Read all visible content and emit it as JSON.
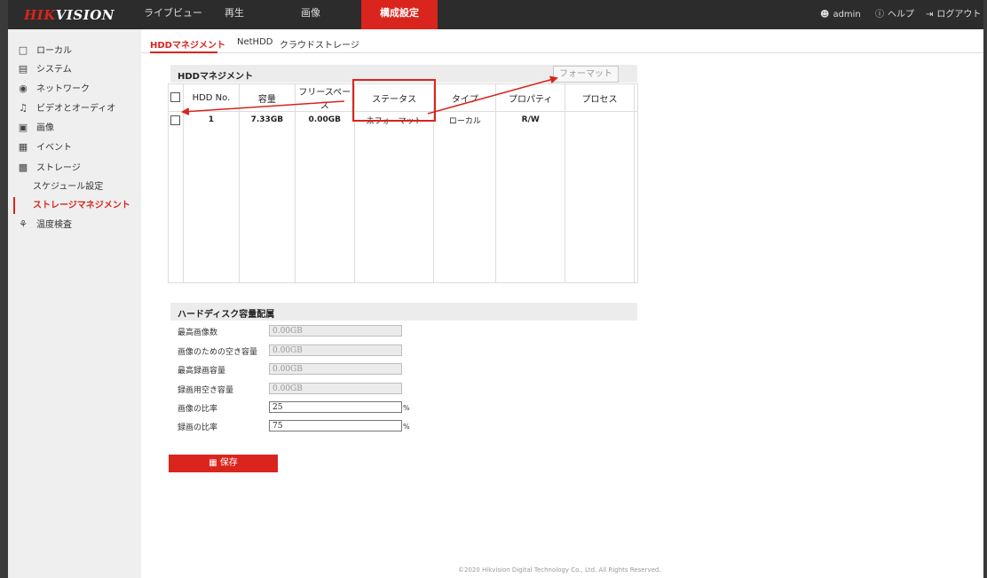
{
  "brand": {
    "red": "HIK",
    "white": "VISION"
  },
  "nav": [
    {
      "label": "ライブビュー",
      "active": false
    },
    {
      "label": "再生",
      "active": false
    },
    {
      "label": "画像",
      "active": false
    },
    {
      "label": "構成設定",
      "active": true
    }
  ],
  "user_menu": {
    "user": "admin",
    "help": "ヘルプ",
    "logout": "ログアウト"
  },
  "sidebar": {
    "items": [
      {
        "label": "ローカル",
        "icon": "monitor-icon"
      },
      {
        "label": "システム",
        "icon": "system-icon"
      },
      {
        "label": "ネットワーク",
        "icon": "network-icon"
      },
      {
        "label": "ビデオとオーディオ",
        "icon": "video-audio-icon"
      },
      {
        "label": "画像",
        "icon": "image-icon"
      },
      {
        "label": "イベント",
        "icon": "calendar-icon"
      },
      {
        "label": "ストレージ",
        "icon": "storage-icon"
      }
    ],
    "sub_items": [
      {
        "label": "スケジュール設定",
        "active": false
      },
      {
        "label": "ストレージマネジメント",
        "active": true
      }
    ],
    "extra": {
      "label": "温度検査",
      "icon": "thermometer-icon"
    }
  },
  "tabs": [
    {
      "label": "HDDマネジメント",
      "active": true
    },
    {
      "label": "NetHDD",
      "active": false
    },
    {
      "label": "クラウドストレージ",
      "active": false
    }
  ],
  "hdd_panel": {
    "title": "HDDマネジメント",
    "format_button": "フォーマット",
    "columns": [
      "HDD No.",
      "容量",
      "フリースペース",
      "ステータス",
      "タイプ",
      "プロパティ",
      "プロセス"
    ],
    "rows": [
      {
        "no": "1",
        "capacity": "7.33GB",
        "free": "0.00GB",
        "status": "未フォーマット",
        "type": "ローカル",
        "property": "R/W",
        "process": ""
      }
    ]
  },
  "capacity_section": {
    "title": "ハードディスク容量配属",
    "fields": [
      {
        "label": "最高画像数",
        "value": "0.00GB",
        "editable": false
      },
      {
        "label": "画像のための空き容量",
        "value": "0.00GB",
        "editable": false
      },
      {
        "label": "最高録画容量",
        "value": "0.00GB",
        "editable": false
      },
      {
        "label": "録画用空き容量",
        "value": "0.00GB",
        "editable": false
      },
      {
        "label": "画像の比率",
        "value": "25",
        "editable": true,
        "unit": "%"
      },
      {
        "label": "録画の比率",
        "value": "75",
        "editable": true,
        "unit": "%"
      }
    ]
  },
  "save_button": "保存",
  "footer": "©2020 Hikvision Digital Technology Co., Ltd. All Rights Reserved.",
  "colors": {
    "accent": "#d9251d",
    "topbar": "#2c2c2c",
    "sidebar": "#efefef"
  }
}
